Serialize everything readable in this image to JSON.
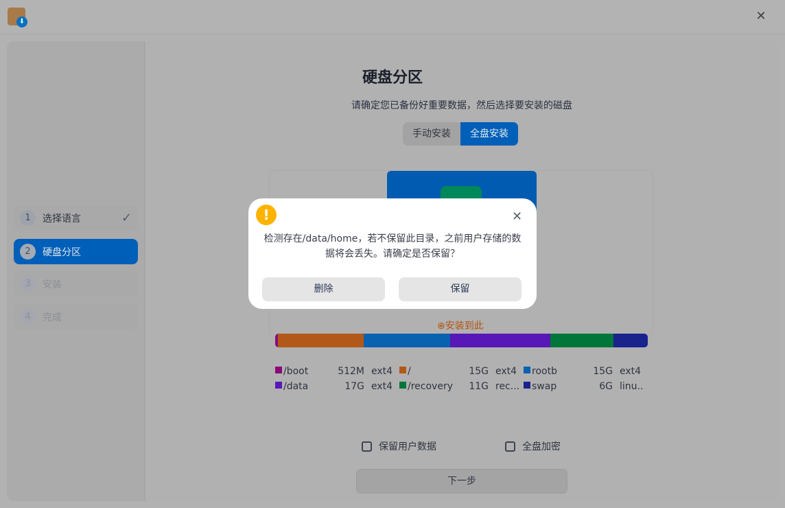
{
  "window": {
    "close_icon": "close-icon"
  },
  "sidebar": {
    "steps": [
      {
        "num": "1",
        "label": "选择语言"
      },
      {
        "num": "2",
        "label": "硬盘分区"
      },
      {
        "num": "3",
        "label": "安装"
      },
      {
        "num": "4",
        "label": "完成"
      }
    ],
    "check": "✓"
  },
  "main": {
    "title": "硬盘分区",
    "subtitle": "请确定您已备份好重要数据，然后选择要安装的磁盘",
    "tabs": [
      "手动安装",
      "全盘安装"
    ],
    "install_here": "安装到此",
    "partitions": [
      {
        "name": "/boot",
        "size": "512M",
        "fs": "ext4",
        "color": "#8a0a7a",
        "weight": 0.5
      },
      {
        "name": "/",
        "size": "15G",
        "fs": "ext4",
        "color": "#b25818",
        "weight": 15
      },
      {
        "name": "rootb",
        "size": "15G",
        "fs": "ext4",
        "color": "#0862b0",
        "weight": 15
      },
      {
        "name": "/data",
        "size": "17G",
        "fs": "ext4",
        "color": "#5818b8",
        "weight": 17.5
      },
      {
        "name": "/recovery",
        "size": "11G",
        "fs": "rec...",
        "color": "#00763a",
        "weight": 11
      },
      {
        "name": "swap",
        "size": "6G",
        "fs": "linu...",
        "color": "#1a228c",
        "weight": 6
      }
    ],
    "keep_user_data": "保留用户数据",
    "full_disk_encrypt": "全盘加密",
    "next": "下一步"
  },
  "dialog": {
    "message": "检测存在/data/home，若不保留此目录，之前用户存储的数据将会丢失。请确定是否保留？",
    "delete": "删除",
    "keep": "保留"
  }
}
